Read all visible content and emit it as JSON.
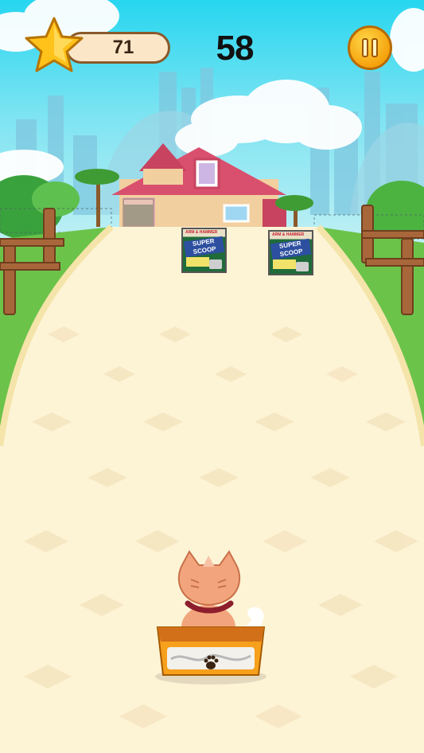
{
  "hud": {
    "score": "71",
    "timer": "58"
  },
  "icons": {
    "star": "star-icon",
    "pause": "pause-icon",
    "paw": "paw-icon"
  },
  "items": {
    "litter_box_label": "SUPER SCOOP",
    "litter_brand": "ARM & HAMMER"
  },
  "colors": {
    "sky": "#27d6f0",
    "path": "#fdf4d6",
    "grass": "#6cc34a",
    "fence": "#a8673a",
    "pause_button": "#f5a20c",
    "star": "#ffc21a"
  }
}
